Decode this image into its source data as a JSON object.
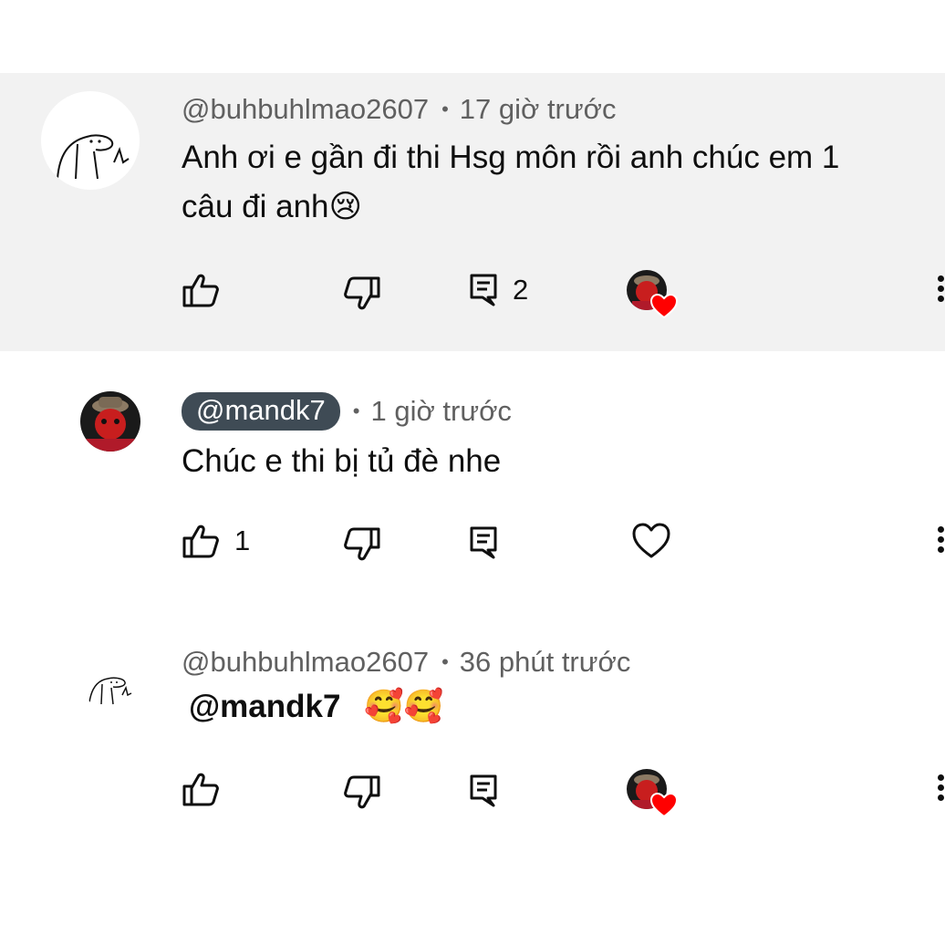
{
  "comments": [
    {
      "author": "@buhbuhlmao2607",
      "time": "17 giờ trước",
      "text_line1": "Anh ơi e gần đi thi Hsg môn rồi anh chúc em 1",
      "text_line2": "câu đi anh",
      "emoji": "😢",
      "reply_count": "2"
    },
    {
      "author": "@mandk7",
      "time": "1 giờ trước",
      "text": "Chúc e thi bị tủ đè nhe",
      "like_count": "1"
    },
    {
      "author": "@buhbuhlmao2607",
      "time": "36 phút trước",
      "mention": "@mandk7",
      "emoji": "🥰🥰"
    }
  ],
  "icons": {
    "like": "thumb-up-icon",
    "dislike": "thumb-down-icon",
    "reply": "reply-icon",
    "heart": "heart-outline-icon",
    "hearted": "creator-heart-icon",
    "more": "more-vert-icon"
  },
  "colors": {
    "highlight_bg": "#f2f2f2",
    "handle_chip": "#3f4b55",
    "heart_red": "#ff0000",
    "meta_text": "#606060"
  }
}
